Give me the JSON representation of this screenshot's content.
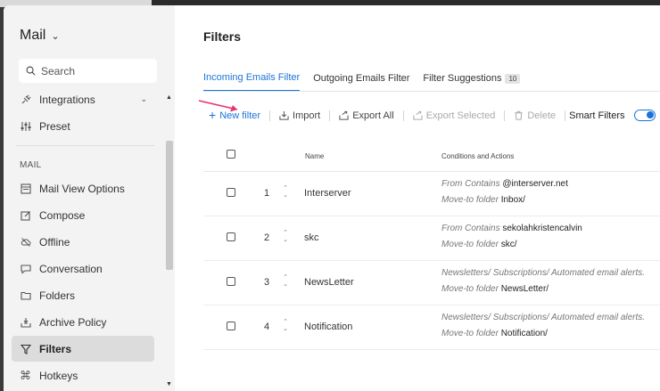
{
  "sidebar": {
    "app_title": "Mail",
    "search_placeholder": "Search",
    "section_label": "MAIL",
    "top_items": [
      {
        "label": "Integrations"
      },
      {
        "label": "Preset"
      }
    ],
    "items": [
      {
        "label": "Mail View Options"
      },
      {
        "label": "Compose"
      },
      {
        "label": "Offline"
      },
      {
        "label": "Conversation"
      },
      {
        "label": "Folders"
      },
      {
        "label": "Archive Policy"
      },
      {
        "label": "Filters"
      },
      {
        "label": "Hotkeys"
      }
    ],
    "active_item": "Filters"
  },
  "main": {
    "title": "Filters",
    "tabs": [
      {
        "label": "Incoming Emails Filter"
      },
      {
        "label": "Outgoing Emails Filter"
      },
      {
        "label": "Filter Suggestions",
        "badge": "10"
      }
    ],
    "toolbar": {
      "new_filter": "New filter",
      "import": "Import",
      "export_all": "Export All",
      "export_selected": "Export Selected",
      "delete": "Delete",
      "smart_filters": "Smart Filters"
    },
    "table": {
      "col_name": "Name",
      "col_conditions": "Conditions and Actions",
      "rows": [
        {
          "num": "1",
          "name": "Interserver",
          "cond_key": "From Contains",
          "cond_val": "@interserver.net",
          "action_key": "Move-to folder",
          "action_val": "Inbox/"
        },
        {
          "num": "2",
          "name": "skc",
          "cond_key": "From Contains",
          "cond_val": "sekolahkristencalvin",
          "action_key": "Move-to folder",
          "action_val": "skc/"
        },
        {
          "num": "3",
          "name": "NewsLetter",
          "cond_key": "Newsletters/ Subscriptions/ Automated email alerts.",
          "cond_val": "",
          "action_key": "Move-to folder",
          "action_val": "NewsLetter/"
        },
        {
          "num": "4",
          "name": "Notification",
          "cond_key": "Newsletters/ Subscriptions/ Automated email alerts.",
          "cond_val": "",
          "action_key": "Move-to folder",
          "action_val": "Notification/"
        }
      ]
    }
  },
  "colors": {
    "accent": "#1a73d9",
    "annotation_arrow": "#e8336d"
  }
}
